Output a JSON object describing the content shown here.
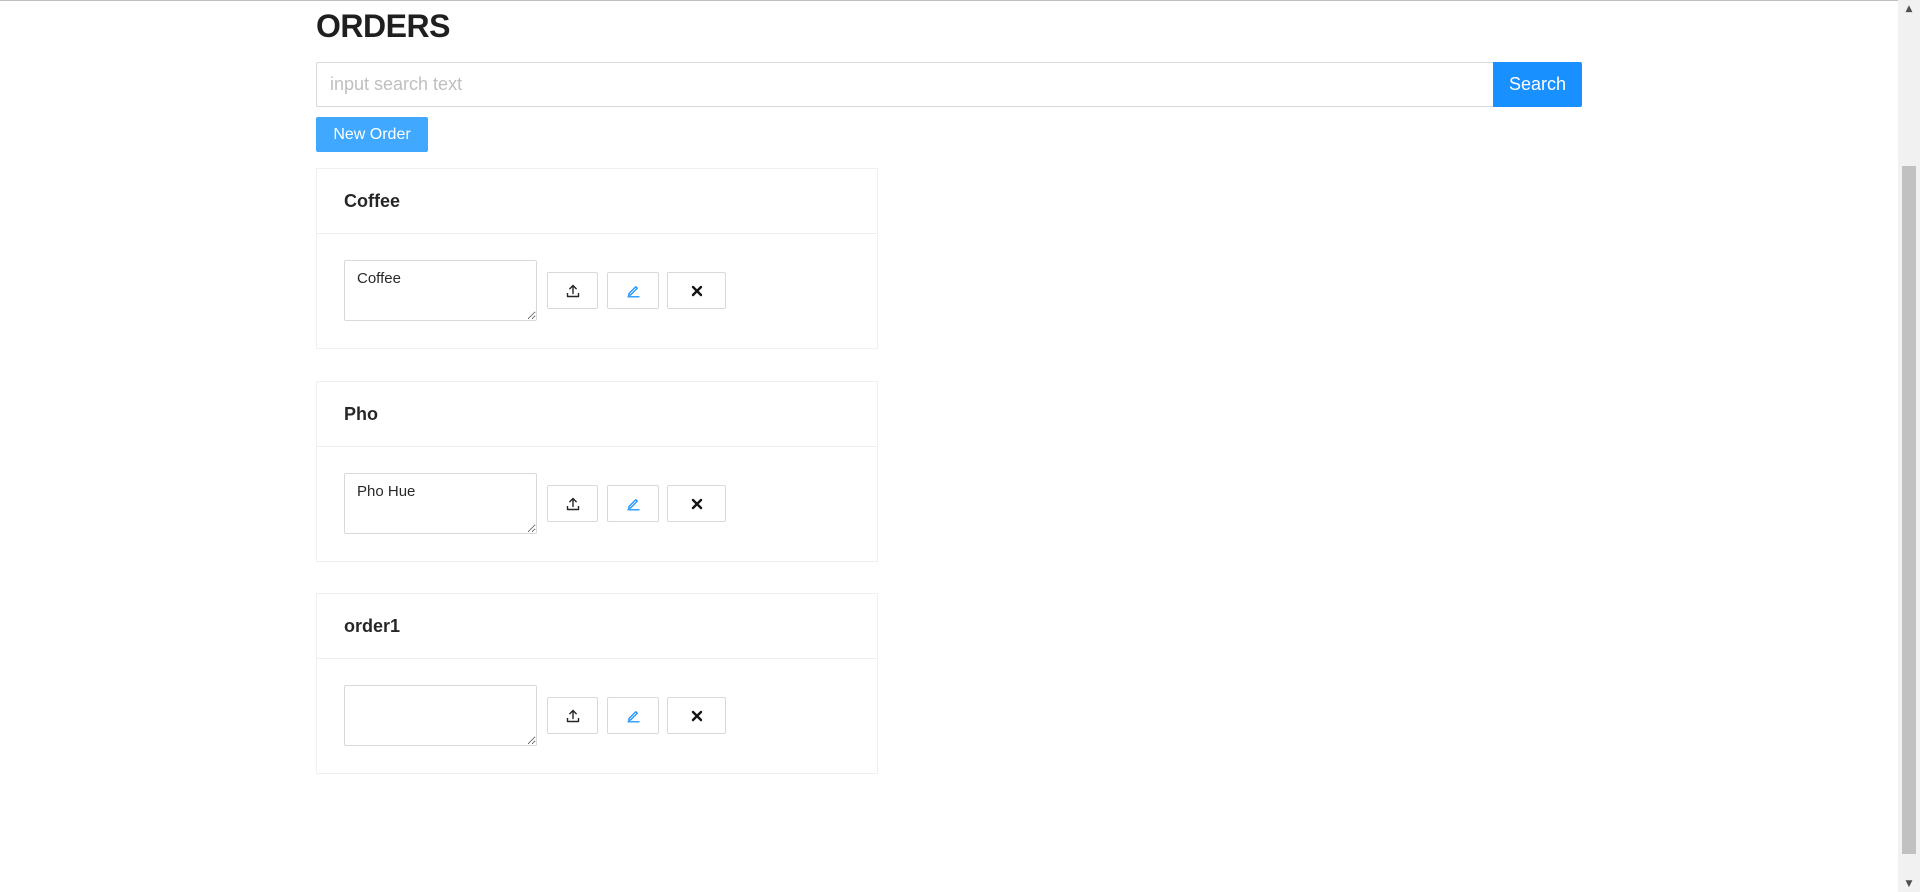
{
  "page": {
    "title": "ORDERS"
  },
  "search": {
    "placeholder": "input search text",
    "value": "",
    "button_label": "Search"
  },
  "toolbar": {
    "new_order_label": "New Order"
  },
  "orders": [
    {
      "name": "Coffee",
      "note": "Coffee"
    },
    {
      "name": "Pho",
      "note": "Pho Hue"
    },
    {
      "name": "order1",
      "note": ""
    }
  ],
  "icons": {
    "upload": "upload-icon",
    "edit": "edit-icon",
    "delete": "close-icon"
  },
  "colors": {
    "primary": "#1890ff",
    "primary_light": "#40a9ff",
    "border": "#d9d9d9",
    "divider": "#f0f0f0"
  }
}
